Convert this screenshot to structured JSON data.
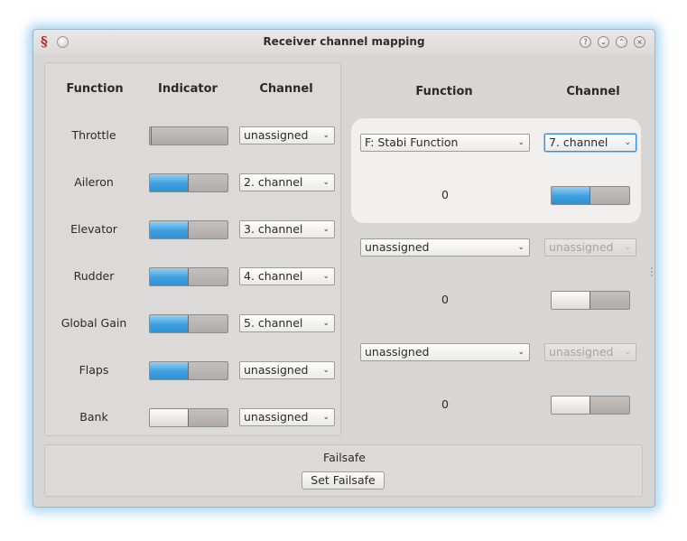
{
  "window": {
    "title": "Receiver channel mapping",
    "app_icon_glyph": "§",
    "app_icon_name": "app-logo-icon",
    "controls": [
      {
        "name": "help-icon",
        "glyph": "?"
      },
      {
        "name": "minimize-icon",
        "glyph": "⌄"
      },
      {
        "name": "maximize-icon",
        "glyph": "⌃"
      },
      {
        "name": "close-icon",
        "glyph": "×"
      }
    ]
  },
  "left_panel": {
    "headers": {
      "function": "Function",
      "indicator": "Indicator",
      "channel": "Channel"
    },
    "rows": [
      {
        "function": "Throttle",
        "level": 0.0,
        "fill": "none",
        "channel": "unassigned"
      },
      {
        "function": "Aileron",
        "level": 0.5,
        "fill": "blue",
        "channel": "2. channel"
      },
      {
        "function": "Elevator",
        "level": 0.5,
        "fill": "blue",
        "channel": "3. channel"
      },
      {
        "function": "Rudder",
        "level": 0.5,
        "fill": "blue",
        "channel": "4. channel"
      },
      {
        "function": "Global Gain",
        "level": 0.5,
        "fill": "blue",
        "channel": "5. channel"
      },
      {
        "function": "Flaps",
        "level": 0.5,
        "fill": "blue",
        "channel": "unassigned"
      },
      {
        "function": "Bank",
        "level": 0.5,
        "fill": "grey",
        "channel": "unassigned"
      }
    ]
  },
  "right_panel": {
    "headers": {
      "function": "Function",
      "channel": "Channel"
    },
    "rows": [
      {
        "function": "F: Stabi Function",
        "channel": "7. channel",
        "channel_enabled": true,
        "value": "0",
        "level": 0.5,
        "fill": "blue",
        "highlighted": true
      },
      {
        "function": "unassigned",
        "channel": "unassigned",
        "channel_enabled": false,
        "value": "0",
        "level": 0.5,
        "fill": "grey",
        "highlighted": false
      },
      {
        "function": "unassigned",
        "channel": "unassigned",
        "channel_enabled": false,
        "value": "0",
        "level": 0.5,
        "fill": "grey",
        "highlighted": false
      }
    ]
  },
  "failsafe": {
    "title": "Failsafe",
    "button_label": "Set Failsafe"
  },
  "colors": {
    "accent_blue": "#3d9fe0",
    "focus_border": "#3b8ed8",
    "window_glow": "#60b0e8",
    "app_icon": "#c0282b"
  }
}
